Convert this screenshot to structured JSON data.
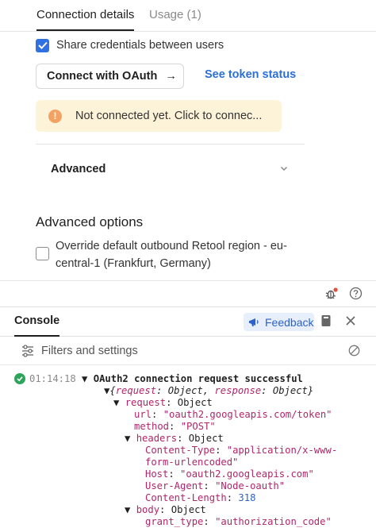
{
  "tabs": [
    {
      "label": "Connection details",
      "active": true
    },
    {
      "label": "Usage (1)",
      "active": false
    }
  ],
  "share_credentials": {
    "label": "Share credentials between users",
    "checked": true
  },
  "connect_button": {
    "label": "Connect with OAuth",
    "arrow": "→"
  },
  "token_link": {
    "label": "See token status"
  },
  "warning": {
    "icon": "!",
    "text": "Not connected yet. Click to connec..."
  },
  "advanced": {
    "label": "Advanced"
  },
  "advanced_options": {
    "title": "Advanced options",
    "override_label": "Override default outbound Retool region - eu-central-1 (Frankfurt, Germany)",
    "override_checked": false
  },
  "console": {
    "tab_label": "Console",
    "feedback_label": "Feedback",
    "filters_label": "Filters and settings"
  },
  "log": {
    "timestamp": "01:14:18",
    "title": "OAuth2 connection request successful",
    "summary_keys": [
      "request",
      "response"
    ],
    "summary_type": "Object",
    "request_key": "request",
    "request_type": "Object",
    "url_key": "url",
    "url_value": "\"oauth2.googleapis.com/token\"",
    "method_key": "method",
    "method_value": "\"POST\"",
    "headers_key": "headers",
    "headers_type": "Object",
    "content_type_key": "Content-Type",
    "content_type_value_1": "\"application/x-www-",
    "content_type_value_2": "form-urlencoded\"",
    "host_key": "Host",
    "host_value": "\"oauth2.googleapis.com\"",
    "user_agent_key": "User-Agent",
    "user_agent_value": "\"Node-oauth\"",
    "content_length_key": "Content-Length",
    "content_length_value": "318",
    "body_key": "body",
    "body_type": "Object",
    "grant_type_key": "grant_type",
    "grant_type_value": "\"authorization_code\""
  },
  "colors": {
    "accent_blue": "#3170e0",
    "link_blue": "#2d6fd8",
    "warning_bg": "#fdf3d8",
    "warning_icon": "#f4a264",
    "success_green": "#2ea45a",
    "log_key": "#b0266a"
  }
}
